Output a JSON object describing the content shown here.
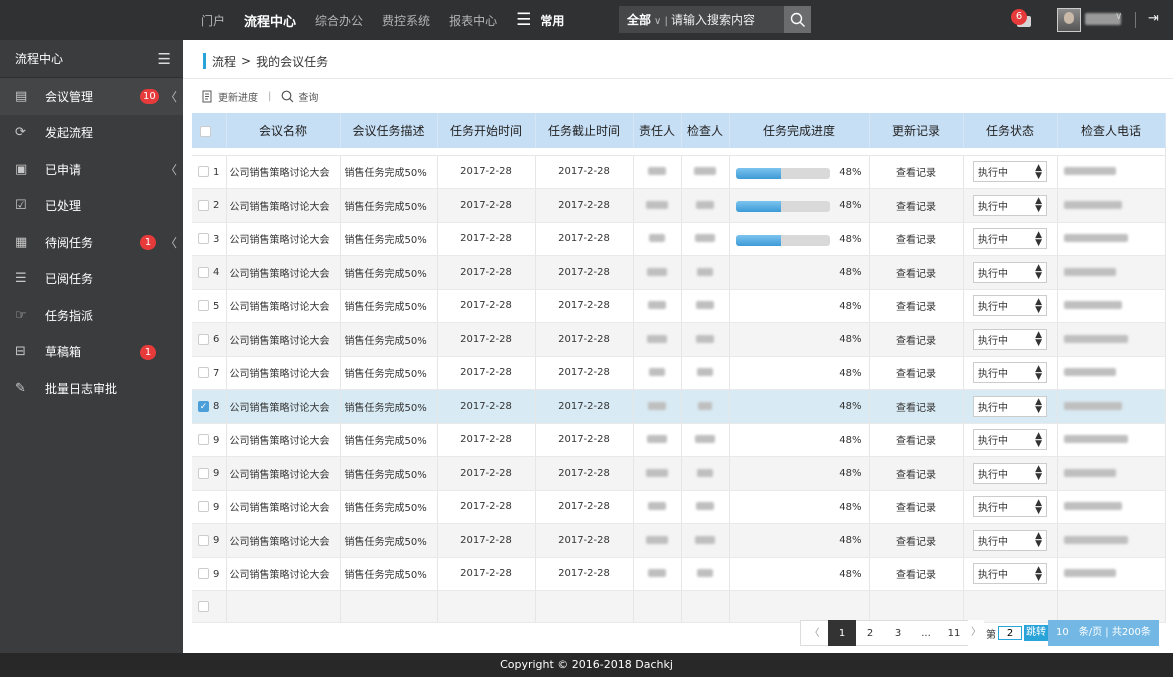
{
  "topbar": {
    "nav": [
      "门户",
      "流程中心",
      "综合办公",
      "费控系统",
      "报表中心"
    ],
    "active_nav": "流程中心",
    "common_label": "常用",
    "search_scope": "全部",
    "search_placeholder": "请输入搜索内容",
    "notification_count": "6"
  },
  "sidebar": {
    "title": "流程中心",
    "items": [
      {
        "label": "会议管理",
        "icon": "document-icon",
        "count": "10",
        "arrow": true
      },
      {
        "label": "发起流程",
        "icon": "refresh-icon",
        "count": "",
        "arrow": false
      },
      {
        "label": "已申请",
        "icon": "copy-icon",
        "count": "",
        "arrow": true
      },
      {
        "label": "已处理",
        "icon": "check-icon",
        "count": "",
        "arrow": false
      },
      {
        "label": "待阅任务",
        "icon": "doc-review-icon",
        "count": "1",
        "arrow": true
      },
      {
        "label": "已阅任务",
        "icon": "list-icon",
        "count": "",
        "arrow": false
      },
      {
        "label": "任务指派",
        "icon": "hand-icon",
        "count": "",
        "arrow": false
      },
      {
        "label": "草稿箱",
        "icon": "tray-icon",
        "count": "1",
        "arrow": false
      },
      {
        "label": "批量日志审批",
        "icon": "edit-icon",
        "count": "",
        "arrow": false
      }
    ]
  },
  "breadcrumb": {
    "root": "流程",
    "separator": ">",
    "current": "我的会议任务"
  },
  "toolbar": {
    "update_label": "更新进度",
    "separator": "|",
    "query_label": "查询"
  },
  "table": {
    "headers": [
      "会议名称",
      "会议任务描述",
      "任务开始时间",
      "任务截止时间",
      "责任人",
      "检查人",
      "任务完成进度",
      "更新记录",
      "任务状态",
      "检查人电话"
    ],
    "rows": [
      {
        "num": "1",
        "name": "公司销售策略讨论大会",
        "desc": "销售任务完成50%",
        "start": "2017-2-28",
        "end": "2017-2-28",
        "progress": 48,
        "progress_text": "48%",
        "show_bar": true,
        "record": "查看记录",
        "status": "执行中",
        "checked": false
      },
      {
        "num": "2",
        "name": "公司销售策略讨论大会",
        "desc": "销售任务完成50%",
        "start": "2017-2-28",
        "end": "2017-2-28",
        "progress": 48,
        "progress_text": "48%",
        "show_bar": true,
        "record": "查看记录",
        "status": "执行中",
        "checked": false
      },
      {
        "num": "3",
        "name": "公司销售策略讨论大会",
        "desc": "销售任务完成50%",
        "start": "2017-2-28",
        "end": "2017-2-28",
        "progress": 48,
        "progress_text": "48%",
        "show_bar": true,
        "record": "查看记录",
        "status": "执行中",
        "checked": false
      },
      {
        "num": "4",
        "name": "公司销售策略讨论大会",
        "desc": "销售任务完成50%",
        "start": "2017-2-28",
        "end": "2017-2-28",
        "progress": 48,
        "progress_text": "48%",
        "show_bar": false,
        "record": "查看记录",
        "status": "执行中",
        "checked": false
      },
      {
        "num": "5",
        "name": "公司销售策略讨论大会",
        "desc": "销售任务完成50%",
        "start": "2017-2-28",
        "end": "2017-2-28",
        "progress": 48,
        "progress_text": "48%",
        "show_bar": false,
        "record": "查看记录",
        "status": "执行中",
        "checked": false
      },
      {
        "num": "6",
        "name": "公司销售策略讨论大会",
        "desc": "销售任务完成50%",
        "start": "2017-2-28",
        "end": "2017-2-28",
        "progress": 48,
        "progress_text": "48%",
        "show_bar": false,
        "record": "查看记录",
        "status": "执行中",
        "checked": false
      },
      {
        "num": "7",
        "name": "公司销售策略讨论大会",
        "desc": "销售任务完成50%",
        "start": "2017-2-28",
        "end": "2017-2-28",
        "progress": 48,
        "progress_text": "48%",
        "show_bar": false,
        "record": "查看记录",
        "status": "执行中",
        "checked": false
      },
      {
        "num": "8",
        "name": "公司销售策略讨论大会",
        "desc": "销售任务完成50%",
        "start": "2017-2-28",
        "end": "2017-2-28",
        "progress": 48,
        "progress_text": "48%",
        "show_bar": false,
        "record": "查看记录",
        "status": "执行中",
        "checked": true
      },
      {
        "num": "9",
        "name": "公司销售策略讨论大会",
        "desc": "销售任务完成50%",
        "start": "2017-2-28",
        "end": "2017-2-28",
        "progress": 48,
        "progress_text": "48%",
        "show_bar": false,
        "record": "查看记录",
        "status": "执行中",
        "checked": false
      },
      {
        "num": "9",
        "name": "公司销售策略讨论大会",
        "desc": "销售任务完成50%",
        "start": "2017-2-28",
        "end": "2017-2-28",
        "progress": 48,
        "progress_text": "48%",
        "show_bar": false,
        "record": "查看记录",
        "status": "执行中",
        "checked": false
      },
      {
        "num": "9",
        "name": "公司销售策略讨论大会",
        "desc": "销售任务完成50%",
        "start": "2017-2-28",
        "end": "2017-2-28",
        "progress": 48,
        "progress_text": "48%",
        "show_bar": false,
        "record": "查看记录",
        "status": "执行中",
        "checked": false
      },
      {
        "num": "9",
        "name": "公司销售策略讨论大会",
        "desc": "销售任务完成50%",
        "start": "2017-2-28",
        "end": "2017-2-28",
        "progress": 48,
        "progress_text": "48%",
        "show_bar": false,
        "record": "查看记录",
        "status": "执行中",
        "checked": false
      },
      {
        "num": "9",
        "name": "公司销售策略讨论大会",
        "desc": "销售任务完成50%",
        "start": "2017-2-28",
        "end": "2017-2-28",
        "progress": 48,
        "progress_text": "48%",
        "show_bar": false,
        "record": "查看记录",
        "status": "执行中",
        "checked": false
      }
    ]
  },
  "pagination": {
    "pages": [
      "1",
      "2",
      "3",
      "...",
      "11"
    ],
    "current": "1",
    "goto_prefix": "第",
    "goto_value": "2",
    "goto_button": "跳转",
    "info": "10　条/页 | 共200条"
  },
  "footer": "Copyright © 2016-2018 Dachkj",
  "colors": {
    "accent": "#2aa3d8",
    "badge": "#e73b3b",
    "header_bg": "#c7dff5",
    "selected_row": "#d8eaf3"
  }
}
